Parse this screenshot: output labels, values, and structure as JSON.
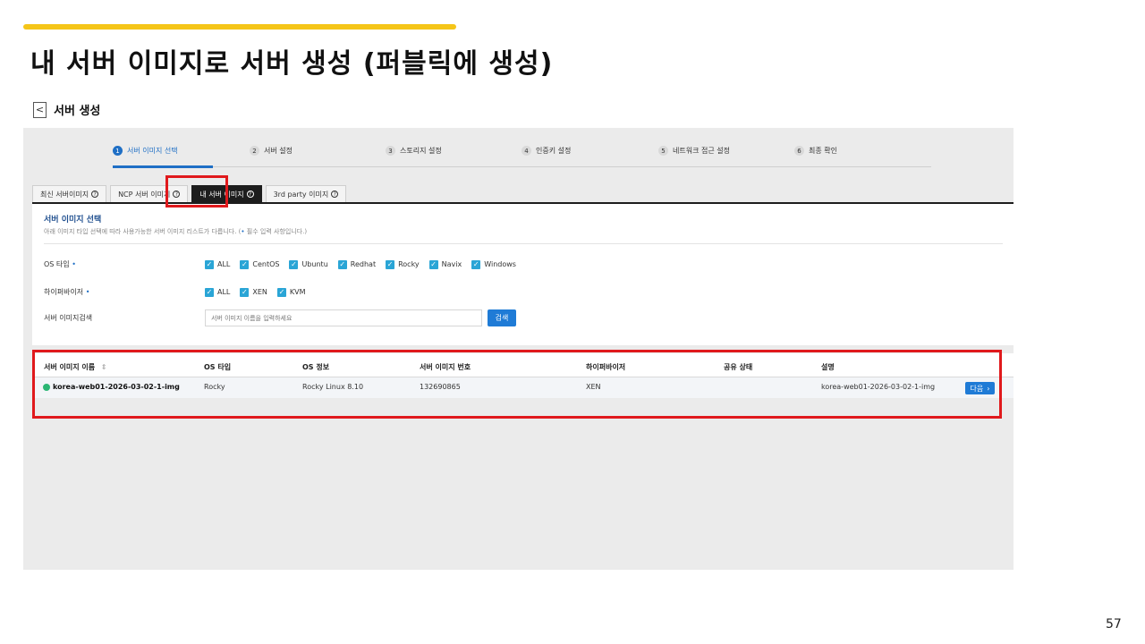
{
  "slide": {
    "title": "내 서버 이미지로 서버 생성  (퍼블릭에 생성)",
    "page_number": "57",
    "accent_color": "#f5c518",
    "highlight_color": "#e0191c"
  },
  "header": {
    "back_icon": "chevron-left-icon",
    "back_glyph": "<",
    "title": "서버 생성"
  },
  "steps": [
    {
      "num": "1",
      "label": "서버 이미지 선택",
      "active": true
    },
    {
      "num": "2",
      "label": "서버 설정"
    },
    {
      "num": "3",
      "label": "스토리지 설정"
    },
    {
      "num": "4",
      "label": "인증키 설정"
    },
    {
      "num": "5",
      "label": "네트워크 접근 설정"
    },
    {
      "num": "6",
      "label": "최종 확인"
    }
  ],
  "tabs": [
    {
      "label": "최신 서버이미지",
      "help": "?"
    },
    {
      "label": "NCP 서버 이미지",
      "help": "?"
    },
    {
      "label": "내 서버 이미지",
      "help": "?",
      "active": true
    },
    {
      "label": "3rd party 이미지",
      "help": "?"
    }
  ],
  "section": {
    "title": "서버 이미지 선택",
    "description": "아래 이미지 타입 선택에 따라 사용가능한 서버 이미지 리스트가 다릅니다. (",
    "required_mark": "•",
    "description_tail": " 필수 입력 사항입니다.)"
  },
  "filters": {
    "os_type": {
      "label": "OS 타입",
      "required": "•",
      "options": [
        "ALL",
        "CentOS",
        "Ubuntu",
        "Redhat",
        "Rocky",
        "Navix",
        "Windows"
      ]
    },
    "hypervisor": {
      "label": "하이퍼바이저",
      "required": "•",
      "options": [
        "ALL",
        "XEN",
        "KVM"
      ]
    },
    "search": {
      "label": "서버 이미지검색",
      "placeholder": "서버 이미지 이름을 입력하세요",
      "button": "검색"
    },
    "check_glyph": "✓"
  },
  "table": {
    "columns": [
      "서버 이미지 이름",
      "OS 타입",
      "OS 정보",
      "서버 이미지 번호",
      "하이퍼바이저",
      "공유 상태",
      "설명"
    ],
    "sort_glyph": "⇕",
    "rows": [
      {
        "name": "korea-web01-2026-03-02-1-img",
        "os_type": "Rocky",
        "os_info": "Rocky Linux 8.10",
        "image_number": "132690865",
        "hypervisor": "XEN",
        "share_status": "",
        "description": "korea-web01-2026-03-02-1-img",
        "status_color": "#2bb673"
      }
    ],
    "next_button": "다음",
    "next_glyph": "›"
  }
}
